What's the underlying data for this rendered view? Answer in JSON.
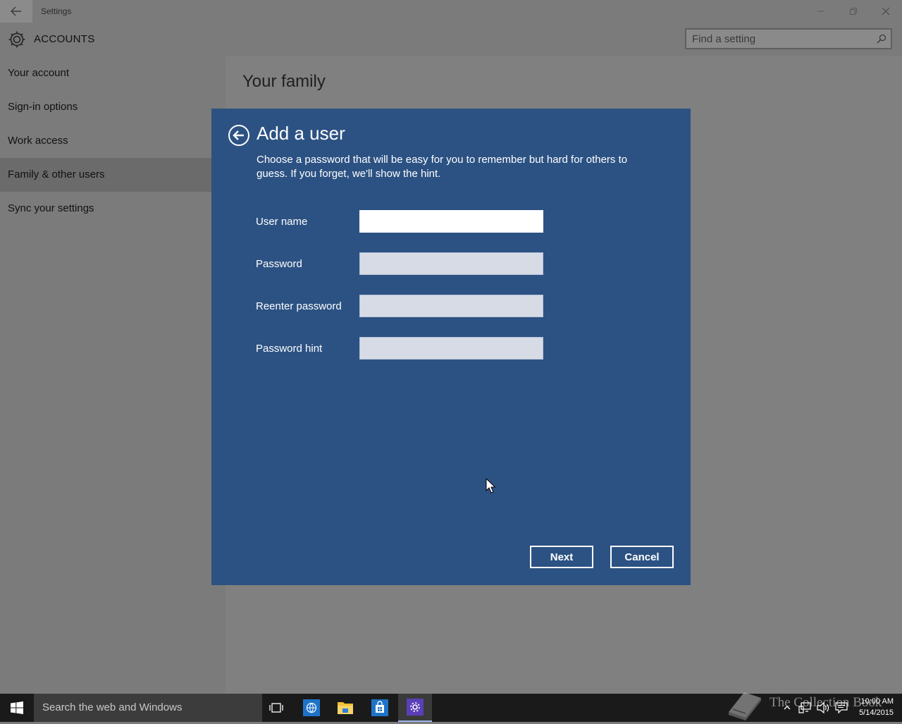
{
  "window": {
    "title": "Settings"
  },
  "header": {
    "app_title": "ACCOUNTS",
    "search_placeholder": "Find a setting"
  },
  "sidebar": {
    "items": [
      {
        "label": "Your account"
      },
      {
        "label": "Sign-in options"
      },
      {
        "label": "Work access"
      },
      {
        "label": "Family & other users",
        "active": true
      },
      {
        "label": "Sync your settings"
      }
    ]
  },
  "main": {
    "page_title": "Your family"
  },
  "dialog": {
    "title": "Add a user",
    "description": "Choose a password that will be easy for you to remember but hard for others to guess. If you forget, we'll show the hint.",
    "fields": [
      {
        "label": "User name",
        "value": ""
      },
      {
        "label": "Password",
        "value": ""
      },
      {
        "label": "Reenter password",
        "value": ""
      },
      {
        "label": "Password hint",
        "value": ""
      }
    ],
    "next_label": "Next",
    "cancel_label": "Cancel"
  },
  "taskbar": {
    "search_text": "Search the web and Windows",
    "time": "10:00 AM",
    "date": "5/14/2015",
    "watermark": "The Collection Book"
  },
  "colors": {
    "dialog_bg": "#2c5283",
    "taskbar_bg": "#1a1a1a",
    "overlay_bg": "#7b7b7b"
  }
}
